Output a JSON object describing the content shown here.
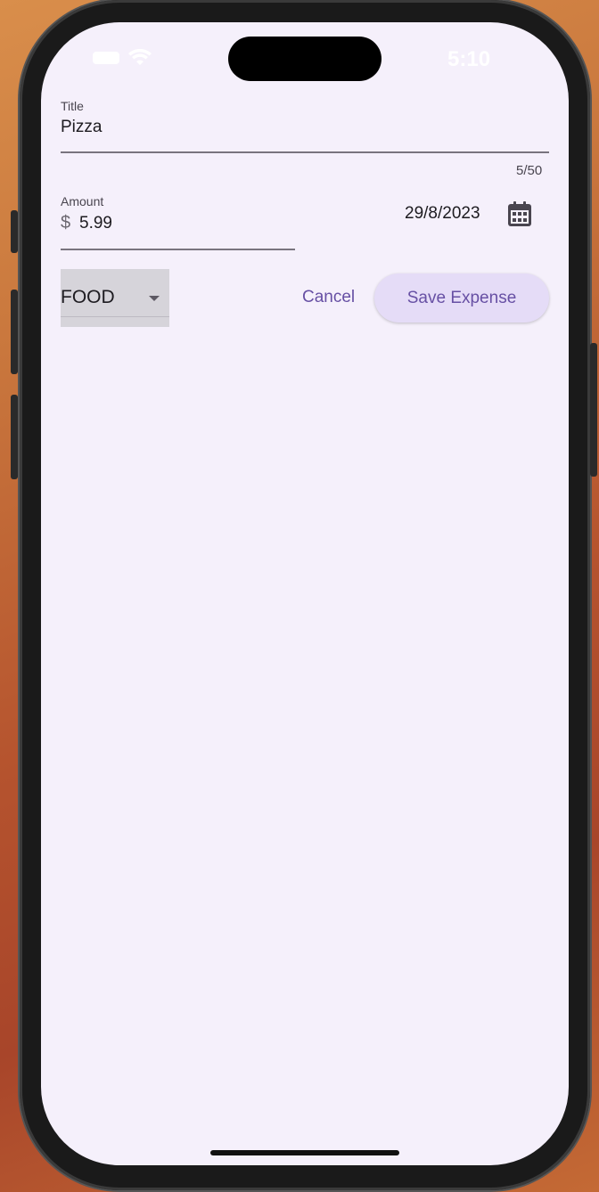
{
  "status_bar": {
    "time": "5:10",
    "icons": [
      "battery-icon",
      "wifi-icon"
    ]
  },
  "form": {
    "title_field": {
      "label": "Title",
      "value": "Pizza",
      "counter": "5/50"
    },
    "amount_field": {
      "label": "Amount",
      "prefix": "$",
      "value": "5.99"
    },
    "date": {
      "value": "29/8/2023",
      "icon": "calendar-icon"
    },
    "category_dropdown": {
      "selected": "FOOD",
      "icon": "dropdown-arrow-icon"
    },
    "actions": {
      "cancel_label": "Cancel",
      "save_label": "Save Expense"
    }
  },
  "colors": {
    "background": "#f5f0fb",
    "accent": "#6750a4",
    "save_button_bg": "#e5dcf7",
    "dropdown_bg": "#d6d4da"
  }
}
